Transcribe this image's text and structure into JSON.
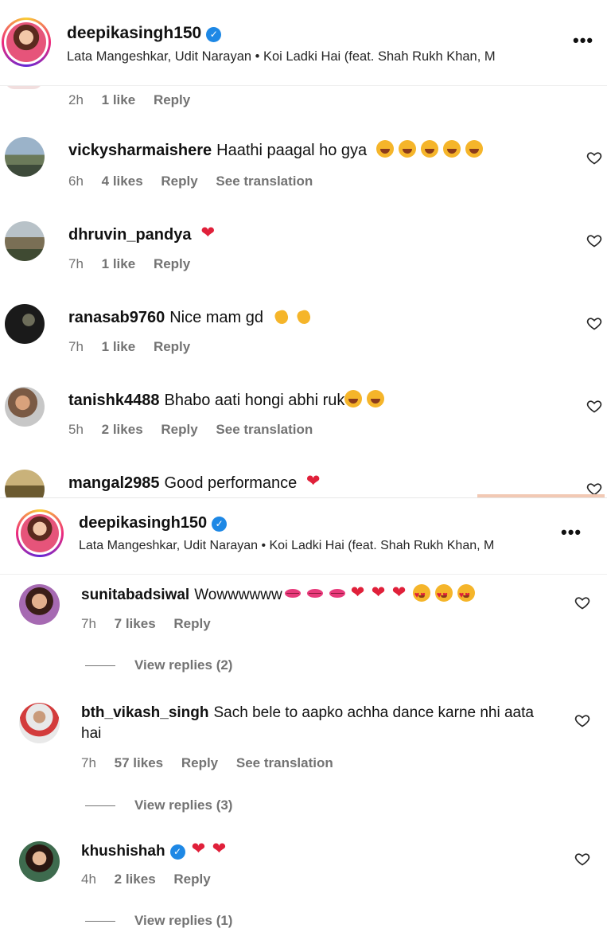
{
  "screenshots": [
    {
      "header": {
        "username": "deepikasingh150",
        "verified": true,
        "audio": "Lata Mangeshkar, Udit Narayan • Koi Ladki Hai (feat. Shah Rukh Khan, M",
        "more": "•••"
      },
      "comments": [
        {
          "username": "",
          "text": "",
          "time": "2h",
          "likes": "1 like",
          "reply": "Reply",
          "translation": null
        },
        {
          "username": "vickysharmaishere",
          "text": "Haathi paagal ho gya",
          "emojis": [
            "laugh",
            "laugh",
            "laugh",
            "laugh",
            "laugh"
          ],
          "time": "6h",
          "likes": "4 likes",
          "reply": "Reply",
          "translation": "See translation"
        },
        {
          "username": "dhruvin_pandya",
          "text": "",
          "emojis": [
            "heart"
          ],
          "time": "7h",
          "likes": "1 like",
          "reply": "Reply",
          "translation": null
        },
        {
          "username": "ranasab9760",
          "text": "Nice mam gd",
          "emojis": [
            "clap",
            "clap"
          ],
          "time": "7h",
          "likes": "1 like",
          "reply": "Reply",
          "translation": null
        },
        {
          "username": "tanishk4488",
          "text": "Bhabo aati hongi abhi ruk",
          "emojis": [
            "laugh",
            "laugh"
          ],
          "time": "5h",
          "likes": "2 likes",
          "reply": "Reply",
          "translation": "See translation"
        },
        {
          "username": "mangal2985",
          "text": "Good performance",
          "emojis": [
            "heart"
          ],
          "time": "",
          "likes": "",
          "reply": "",
          "translation": null
        }
      ]
    },
    {
      "header": {
        "username": "deepikasingh150",
        "verified": true,
        "audio": "Lata Mangeshkar, Udit Narayan • Koi Ladki Hai (feat. Shah Rukh Khan, M",
        "more": "•••"
      },
      "comments": [
        {
          "username": "sunitabadsiwal",
          "text": "Wowwwwww",
          "emojis": [
            "kiss",
            "kiss",
            "kiss",
            "heart",
            "heart",
            "heart",
            "hearteyes",
            "hearteyes",
            "hearteyes"
          ],
          "time": "7h",
          "likes": "7 likes",
          "reply": "Reply",
          "translation": null,
          "view_replies": "View replies (2)"
        },
        {
          "username": "bth_vikash_singh",
          "text": "Sach bele to aapko achha dance karne nhi aata hai",
          "emojis": [],
          "time": "7h",
          "likes": "57 likes",
          "reply": "Reply",
          "translation": "See translation",
          "view_replies": "View replies (3)"
        },
        {
          "username": "khushishah",
          "verified": true,
          "text": "",
          "emojis": [
            "heart",
            "heart"
          ],
          "time": "4h",
          "likes": "2 likes",
          "reply": "Reply",
          "translation": null,
          "view_replies": "View replies (1)"
        }
      ]
    }
  ],
  "colors": {
    "text": "#111111",
    "muted": "#737373",
    "verified": "#1e88e5",
    "heart": "#e0203a",
    "strip": "#f2c9b4"
  },
  "icons": {
    "verified": "verified-badge-icon",
    "like": "heart-outline-icon",
    "more": "more-options-icon"
  }
}
